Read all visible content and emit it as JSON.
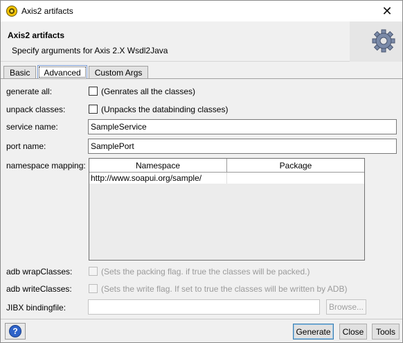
{
  "window": {
    "title": "Axis2 artifacts",
    "close_glyph": "✕"
  },
  "header": {
    "title": "Axis2 artifacts",
    "subtitle": "Specify arguments for Axis 2.X Wsdl2Java",
    "icon": "gear-icon"
  },
  "tabs": [
    {
      "label": "Basic",
      "active": false
    },
    {
      "label": "Advanced",
      "active": true
    },
    {
      "label": "Custom Args",
      "active": false
    }
  ],
  "form": {
    "generate_all": {
      "label": "generate all:",
      "checked": false,
      "text": "(Genrates all the classes)"
    },
    "unpack_classes": {
      "label": "unpack classes:",
      "checked": false,
      "text": "(Unpacks the databinding classes)"
    },
    "service_name": {
      "label": "service name:",
      "value": "SampleService"
    },
    "port_name": {
      "label": "port name:",
      "value": "SamplePort"
    },
    "namespace_mapping": {
      "label": "namespace mapping:",
      "columns": [
        "Namespace",
        "Package"
      ],
      "rows": [
        {
          "namespace": "http://www.soapui.org/sample/",
          "package": ""
        }
      ]
    },
    "adb_wrap": {
      "label": "adb wrapClasses:",
      "checked": false,
      "disabled": true,
      "text": "(Sets the packing flag. if true the classes will be packed.)"
    },
    "adb_write": {
      "label": "adb writeClasses:",
      "checked": false,
      "disabled": true,
      "text": "(Sets the write flag. If set to true the classes will be written by ADB)"
    },
    "jibx": {
      "label": "JIBX bindingfile:",
      "value": "",
      "browse_label": "Browse..."
    }
  },
  "footer": {
    "help_glyph": "?",
    "generate_label": "Generate",
    "close_label": "Close",
    "tools_label": "Tools"
  },
  "colors": {
    "accent": "#2e63c9",
    "default_button_border": "#3c7fb1"
  }
}
